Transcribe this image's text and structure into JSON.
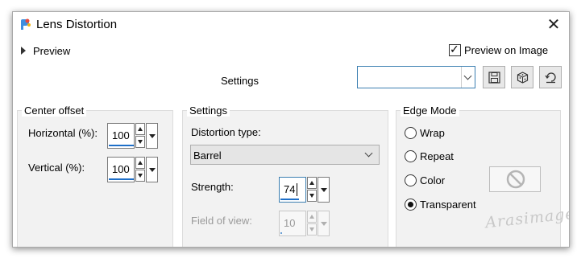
{
  "window": {
    "title": "Lens Distortion",
    "close_glyph": "✕"
  },
  "preview": {
    "toggle_label": "Preview",
    "preview_on_image_label": "Preview on Image",
    "preview_on_image_checked": true
  },
  "toolbar": {
    "settings_label": "Settings",
    "preset_value": "",
    "icons": [
      "save-icon",
      "randomize-icon",
      "reset-icon"
    ]
  },
  "center_offset": {
    "title": "Center offset",
    "horizontal": {
      "label": "Horizontal (%):",
      "value": "100"
    },
    "vertical": {
      "label": "Vertical (%):",
      "value": "100"
    }
  },
  "settings": {
    "title": "Settings",
    "distortion_type_label": "Distortion type:",
    "distortion_type_value": "Barrel",
    "strength": {
      "label": "Strength:",
      "value": "74"
    },
    "field_of_view": {
      "label": "Field of view:",
      "value": "10",
      "disabled": true
    }
  },
  "edge_mode": {
    "title": "Edge Mode",
    "options": [
      {
        "label": "Wrap",
        "selected": false
      },
      {
        "label": "Repeat",
        "selected": false
      },
      {
        "label": "Color",
        "selected": false
      },
      {
        "label": "Transparent",
        "selected": true
      }
    ],
    "color_swatch_icon": "no-symbol-icon"
  },
  "watermark": {
    "text": "Arasimages"
  },
  "colors": {
    "accent": "#1e6fc8",
    "group_bg": "#f2f2f2",
    "disabled_text": "#9a9a9a"
  }
}
